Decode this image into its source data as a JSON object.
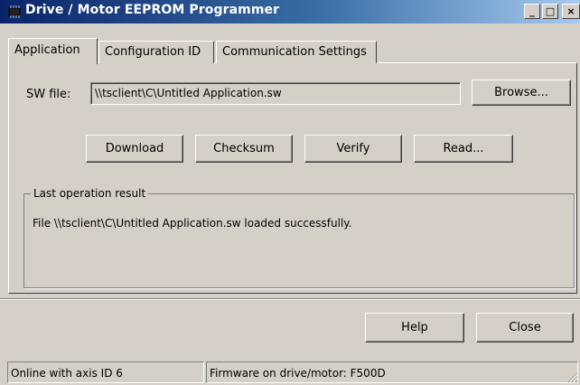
{
  "window": {
    "title": "Drive / Motor EEPROM Programmer",
    "icon": "chip-icon",
    "controls": {
      "minimize": "_",
      "maximize": "□",
      "close": "×"
    }
  },
  "tabs": [
    {
      "label": "Application",
      "active": true
    },
    {
      "label": "Configuration ID",
      "active": false
    },
    {
      "label": "Communication Settings",
      "active": false
    }
  ],
  "application": {
    "sw_file_label": "SW file:",
    "sw_file_value": "\\\\tsclient\\C\\Untitled Application.sw",
    "browse_label": "Browse...",
    "actions": {
      "download": "Download",
      "checksum": "Checksum",
      "verify": "Verify",
      "read": "Read..."
    },
    "result_group_label": "Last operation result",
    "result_text": "File \\\\tsclient\\C\\Untitled Application.sw loaded successfully."
  },
  "footer": {
    "help_label": "Help",
    "close_label": "Close"
  },
  "status": {
    "connection": "Online with axis ID 6",
    "firmware": "Firmware on drive/motor: F500D"
  }
}
